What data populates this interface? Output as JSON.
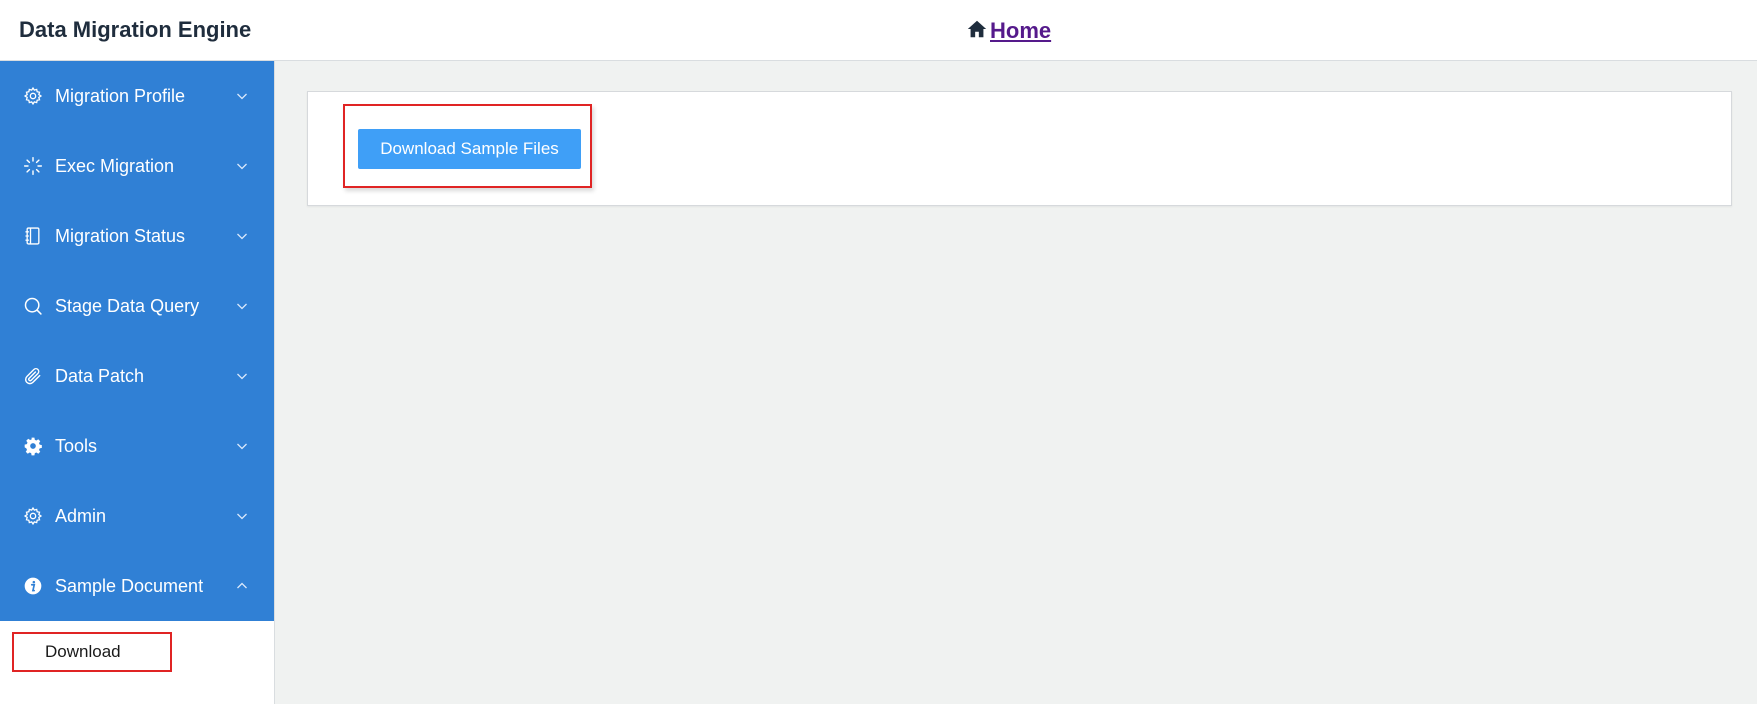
{
  "header": {
    "app_title": "Data Migration Engine",
    "home_label": "Home"
  },
  "sidebar": {
    "items": [
      {
        "label": "Migration Profile",
        "icon": "gear-outline-icon",
        "expanded": false
      },
      {
        "label": "Exec Migration",
        "icon": "spinner-icon",
        "expanded": false
      },
      {
        "label": "Migration Status",
        "icon": "notebook-icon",
        "expanded": false
      },
      {
        "label": "Stage Data Query",
        "icon": "search-icon",
        "expanded": false
      },
      {
        "label": "Data Patch",
        "icon": "paperclip-icon",
        "expanded": false
      },
      {
        "label": "Tools",
        "icon": "gear-solid-icon",
        "expanded": false
      },
      {
        "label": "Admin",
        "icon": "gear-outline-icon",
        "expanded": false
      },
      {
        "label": "Sample Document",
        "icon": "info-icon",
        "expanded": true
      }
    ],
    "submenu": {
      "download_label": "Download"
    }
  },
  "main": {
    "download_button_label": "Download Sample Files"
  },
  "colors": {
    "sidebar_bg": "#3080d5",
    "button_bg": "#3f9ff7",
    "highlight_border": "#e02424",
    "link": "#551a8b"
  }
}
